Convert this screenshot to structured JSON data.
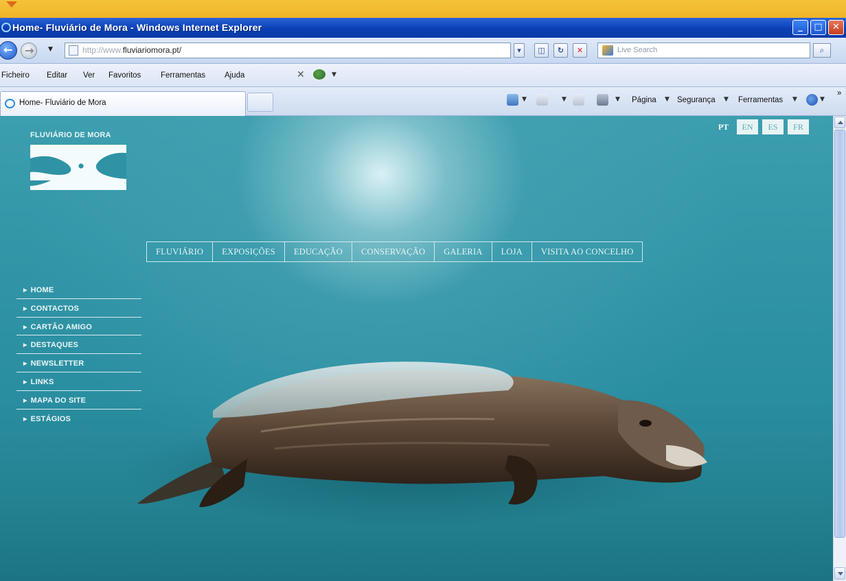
{
  "window": {
    "title": "Home- Fluviário de Mora - Windows Internet Explorer"
  },
  "address": {
    "url_prefix": "http://www.",
    "url_domain": "fluviariomora.pt/",
    "search_placeholder": "Live Search"
  },
  "menu": [
    "Ficheiro",
    "Editar",
    "Ver",
    "Favoritos",
    "Ferramentas",
    "Ajuda"
  ],
  "tab": {
    "label": "Home- Fluviário de Mora"
  },
  "command_bar": {
    "page": "Página",
    "security": "Segurança",
    "tools": "Ferramentas",
    "more": "»"
  },
  "site": {
    "logo_title": "FLUVIÁRIO DE MORA",
    "languages": [
      "PT",
      "EN",
      "ES",
      "FR"
    ],
    "active_language": "PT",
    "top_nav": [
      "FLUVIÁRIO",
      "EXPOSIÇÕES",
      "EDUCAÇÃO",
      "CONSERVAÇÃO",
      "GALERIA",
      "LOJA",
      "VISITA AO CONCELHO"
    ],
    "side_nav": [
      "HOME",
      "CONTACTOS",
      "CARTÃO AMIGO",
      "DESTAQUES",
      "NEWSLETTER",
      "LINKS",
      "MAPA DO SITE",
      "ESTÁGIOS"
    ]
  },
  "colors": {
    "titlebar": "#0b3aa8",
    "water": "#2a8ea1",
    "nav_text": "#e6f5f7"
  }
}
